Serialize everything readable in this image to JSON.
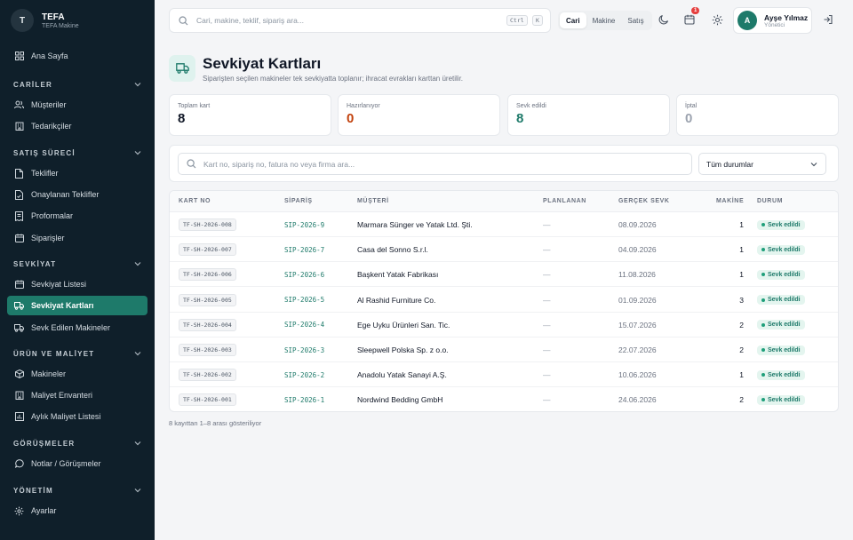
{
  "brand": {
    "initial": "T",
    "title": "TEFA",
    "subtitle": "TEFA Makine"
  },
  "sidebar": {
    "home": {
      "label": "Ana Sayfa",
      "icon": "grid-icon"
    },
    "groups": [
      {
        "label": "CARİLER",
        "items": [
          {
            "label": "Müşteriler",
            "icon": "users-icon"
          },
          {
            "label": "Tedarikçiler",
            "icon": "building-icon"
          }
        ]
      },
      {
        "label": "SATIŞ SÜRECİ",
        "items": [
          {
            "label": "Teklifler",
            "icon": "file-icon"
          },
          {
            "label": "Onaylanan Teklifler",
            "icon": "file-check-icon"
          },
          {
            "label": "Proformalar",
            "icon": "receipt-icon"
          },
          {
            "label": "Siparişler",
            "icon": "calendar-icon"
          }
        ]
      },
      {
        "label": "SEVKİYAT",
        "items": [
          {
            "label": "Sevkiyat Listesi",
            "icon": "calendar-icon"
          },
          {
            "label": "Sevkiyat Kartları",
            "icon": "truck-icon",
            "active": true
          },
          {
            "label": "Sevk Edilen Makineler",
            "icon": "truck-icon"
          }
        ]
      },
      {
        "label": "ÜRÜN VE MALİYET",
        "items": [
          {
            "label": "Makineler",
            "icon": "box-icon"
          },
          {
            "label": "Maliyet Envanteri",
            "icon": "building-icon"
          },
          {
            "label": "Aylık Maliyet Listesi",
            "icon": "chart-icon"
          }
        ]
      },
      {
        "label": "GÖRÜŞMELER",
        "items": [
          {
            "label": "Notlar / Görüşmeler",
            "icon": "chat-icon"
          }
        ]
      },
      {
        "label": "YÖNETİM",
        "items": [
          {
            "label": "Ayarlar",
            "icon": "gear-icon"
          }
        ]
      }
    ]
  },
  "topbar": {
    "search_placeholder": "Cari, makine, teklif, sipariş ara...",
    "kbd": [
      "Ctrl",
      "K"
    ],
    "segments": [
      {
        "label": "Cari",
        "on": true
      },
      {
        "label": "Makine",
        "on": false
      },
      {
        "label": "Satış",
        "on": false
      }
    ],
    "notification_count": "1",
    "user": {
      "initial": "A",
      "name": "Ayşe Yılmaz",
      "role": "Yönetici"
    }
  },
  "page": {
    "title": "Sevkiyat Kartları",
    "subtitle": "Siparişten seçilen makineler tek sevkiyatta toplanır; ihracat evrakları karttan üretilir."
  },
  "stats": [
    {
      "label": "Toplam kart",
      "value": "8",
      "color": "#111827"
    },
    {
      "label": "Hazırlanıyor",
      "value": "0",
      "color": "#c2410c"
    },
    {
      "label": "Sevk edildi",
      "value": "8",
      "color": "#1e7a6a"
    },
    {
      "label": "İptal",
      "value": "0",
      "color": "#9ca3af"
    }
  ],
  "filter": {
    "search_placeholder": "Kart no, sipariş no, fatura no veya firma ara...",
    "status_value": "Tüm durumlar"
  },
  "table": {
    "headers": {
      "card": "KART NO",
      "order": "SİPARİŞ",
      "customer": "MÜŞTERİ",
      "planned": "PLANLANAN",
      "actual": "GERÇEK SEVK",
      "machines": "MAKİNE",
      "status": "DURUM"
    },
    "rows": [
      {
        "card": "TF-SH-2026-008",
        "order": "SIP-2026-9",
        "customer": "Marmara Sünger ve Yatak Ltd. Şti.",
        "planned": "—",
        "actual": "08.09.2026",
        "machines": "1",
        "status": "Sevk edildi"
      },
      {
        "card": "TF-SH-2026-007",
        "order": "SIP-2026-7",
        "customer": "Casa del Sonno S.r.l.",
        "planned": "—",
        "actual": "04.09.2026",
        "machines": "1",
        "status": "Sevk edildi"
      },
      {
        "card": "TF-SH-2026-006",
        "order": "SIP-2026-6",
        "customer": "Başkent Yatak Fabrikası",
        "planned": "—",
        "actual": "11.08.2026",
        "machines": "1",
        "status": "Sevk edildi"
      },
      {
        "card": "TF-SH-2026-005",
        "order": "SIP-2026-5",
        "customer": "Al Rashid Furniture Co.",
        "planned": "—",
        "actual": "01.09.2026",
        "machines": "3",
        "status": "Sevk edildi"
      },
      {
        "card": "TF-SH-2026-004",
        "order": "SIP-2026-4",
        "customer": "Ege Uyku Ürünleri San. Tic.",
        "planned": "—",
        "actual": "15.07.2026",
        "machines": "2",
        "status": "Sevk edildi"
      },
      {
        "card": "TF-SH-2026-003",
        "order": "SIP-2026-3",
        "customer": "Sleepwell Polska Sp. z o.o.",
        "planned": "—",
        "actual": "22.07.2026",
        "machines": "2",
        "status": "Sevk edildi"
      },
      {
        "card": "TF-SH-2026-002",
        "order": "SIP-2026-2",
        "customer": "Anadolu Yatak Sanayi A.Ş.",
        "planned": "—",
        "actual": "10.06.2026",
        "machines": "1",
        "status": "Sevk edildi"
      },
      {
        "card": "TF-SH-2026-001",
        "order": "SIP-2026-1",
        "customer": "Nordwind Bedding GmbH",
        "planned": "—",
        "actual": "24.06.2026",
        "machines": "2",
        "status": "Sevk edildi"
      }
    ]
  },
  "footer_note": "8 kayıttan 1–8 arası gösteriliyor",
  "colors": {
    "accent": "#1e7a6a",
    "sidebar_bg": "#0f1f2a"
  }
}
